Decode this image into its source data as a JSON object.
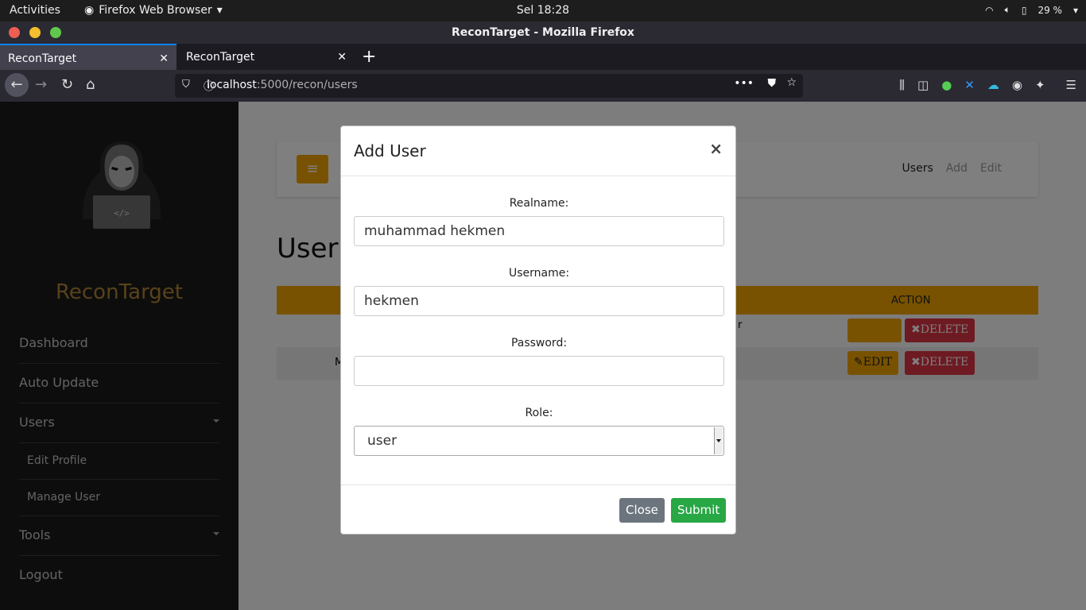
{
  "system": {
    "activities": "Activities",
    "app_name": "Firefox Web Browser",
    "clock": "Sel 18:28",
    "battery": "29 %"
  },
  "window": {
    "title": "ReconTarget - Mozilla Firefox"
  },
  "tabs": [
    {
      "label": "ReconTarget"
    },
    {
      "label": "ReconTarget"
    }
  ],
  "urlbar": {
    "host": "localhost",
    "path": ":5000/recon/users"
  },
  "sidebar": {
    "brand": "ReconTarget",
    "items": [
      {
        "label": "Dashboard"
      },
      {
        "label": "Auto Update"
      },
      {
        "label": "Users"
      },
      {
        "label": "Edit Profile"
      },
      {
        "label": "Manage User"
      },
      {
        "label": "Tools"
      },
      {
        "label": "Logout"
      }
    ]
  },
  "page": {
    "nav": {
      "users": "Users",
      "add": "Add",
      "edit": "Edit"
    },
    "title": "User",
    "table": {
      "action_header": "ACTION",
      "row1_partial": "r",
      "row2_partial": "M",
      "edit_label": "EDIT",
      "delete_label": "DELETE"
    }
  },
  "modal": {
    "title": "Add User",
    "realname_label": "Realname:",
    "realname_value": "muhammad hekmen",
    "username_label": "Username:",
    "username_value": "hekmen",
    "password_label": "Password:",
    "password_value": "",
    "role_label": "Role:",
    "role_value": "user",
    "close_label": "Close",
    "submit_label": "Submit"
  },
  "colors": {
    "accent": "#f0a500",
    "danger": "#dc3545",
    "success": "#28a745",
    "secondary": "#6c757d",
    "brand": "#b08535"
  }
}
